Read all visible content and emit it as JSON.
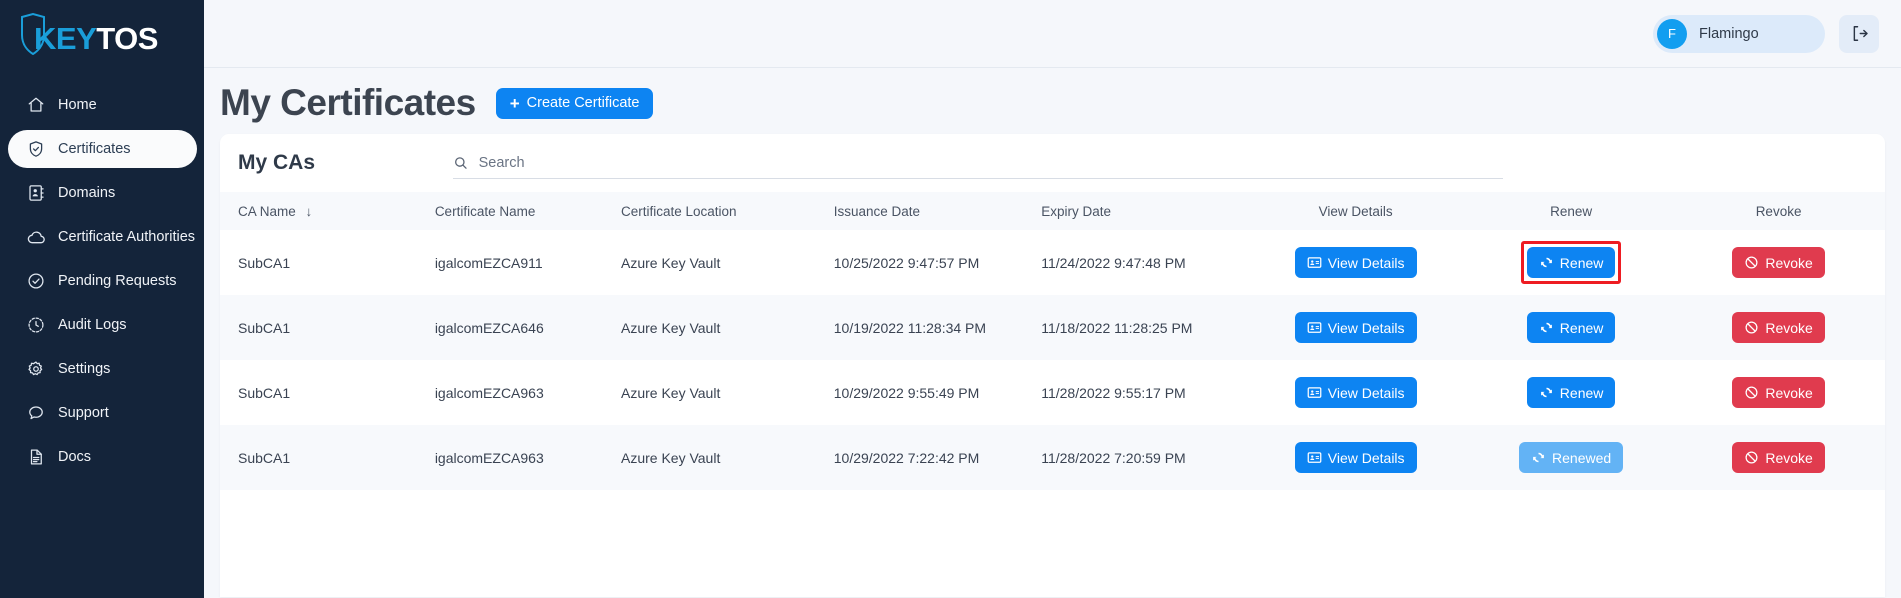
{
  "brand": {
    "logo_key": "KEY",
    "logo_tos": "TOS",
    "accent_blue": "#1a9ed9",
    "sidebar_bg": "#14243a"
  },
  "sidebar": {
    "items": [
      {
        "label": "Home",
        "icon": "home-icon",
        "active": false
      },
      {
        "label": "Certificates",
        "icon": "shield-check-icon",
        "active": true
      },
      {
        "label": "Domains",
        "icon": "contact-card-icon",
        "active": false
      },
      {
        "label": "Certificate Authorities",
        "icon": "cloud-icon",
        "active": false
      },
      {
        "label": "Pending Requests",
        "icon": "check-circle-icon",
        "active": false
      },
      {
        "label": "Audit Logs",
        "icon": "clock-dashed-icon",
        "active": false
      },
      {
        "label": "Settings",
        "icon": "gear-icon",
        "active": false
      },
      {
        "label": "Support",
        "icon": "chat-bubble-icon",
        "active": false
      },
      {
        "label": "Docs",
        "icon": "document-icon",
        "active": false
      }
    ]
  },
  "topbar": {
    "user_initial": "F",
    "user_name": "Flamingo",
    "logout_icon": "logout-icon"
  },
  "page": {
    "title": "My Certificates",
    "create_button": "Create Certificate",
    "create_icon": "plus-icon"
  },
  "card": {
    "title": "My CAs",
    "search_placeholder": "Search",
    "search_value": "",
    "search_icon": "search-icon"
  },
  "table": {
    "columns": [
      {
        "label": "CA Name",
        "sort": "↓",
        "align": "left"
      },
      {
        "label": "Certificate Name",
        "sort": "",
        "align": "left"
      },
      {
        "label": "Certificate Location",
        "sort": "",
        "align": "left"
      },
      {
        "label": "Issuance Date",
        "sort": "",
        "align": "left"
      },
      {
        "label": "Expiry Date",
        "sort": "",
        "align": "left"
      },
      {
        "label": "View Details",
        "sort": "",
        "align": "center"
      },
      {
        "label": "Renew",
        "sort": "",
        "align": "center"
      },
      {
        "label": "Revoke",
        "sort": "",
        "align": "center"
      }
    ],
    "rows": [
      {
        "ca_name": "SubCA1",
        "certificate_name": "igalcomEZCA911",
        "certificate_location": "Azure Key Vault",
        "issuance_date": "10/25/2022 9:47:57 PM",
        "expiry_date": "11/24/2022 9:47:48 PM",
        "view_label": "View Details",
        "renew_label": "Renew",
        "renew_state": "enabled",
        "renew_highlighted": true,
        "revoke_label": "Revoke"
      },
      {
        "ca_name": "SubCA1",
        "certificate_name": "igalcomEZCA646",
        "certificate_location": "Azure Key Vault",
        "issuance_date": "10/19/2022 11:28:34 PM",
        "expiry_date": "11/18/2022 11:28:25 PM",
        "view_label": "View Details",
        "renew_label": "Renew",
        "renew_state": "enabled",
        "renew_highlighted": false,
        "revoke_label": "Revoke"
      },
      {
        "ca_name": "SubCA1",
        "certificate_name": "igalcomEZCA963",
        "certificate_location": "Azure Key Vault",
        "issuance_date": "10/29/2022 9:55:49 PM",
        "expiry_date": "11/28/2022 9:55:17 PM",
        "view_label": "View Details",
        "renew_label": "Renew",
        "renew_state": "enabled",
        "renew_highlighted": false,
        "revoke_label": "Revoke"
      },
      {
        "ca_name": "SubCA1",
        "certificate_name": "igalcomEZCA963",
        "certificate_location": "Azure Key Vault",
        "issuance_date": "10/29/2022 7:22:42 PM",
        "expiry_date": "11/28/2022 7:20:59 PM",
        "view_label": "View Details",
        "renew_label": "Renewed",
        "renew_state": "disabled",
        "renew_highlighted": false,
        "revoke_label": "Revoke"
      }
    ]
  },
  "colors": {
    "primary_blue": "#0d84f2",
    "disabled_blue": "#63b3f5",
    "danger_red": "#e03b4e",
    "highlight_red": "#ee1c22"
  }
}
